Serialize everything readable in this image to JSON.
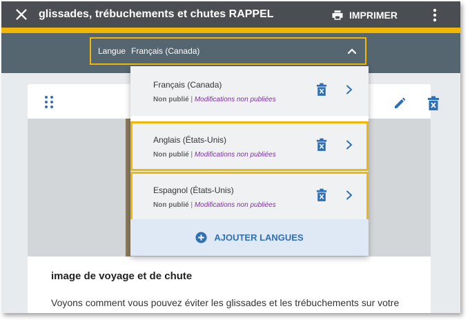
{
  "header": {
    "title": "glissades, trébuchements et chutes RAPPEL",
    "print_label": "IMPRIMER"
  },
  "language_selector": {
    "label": "Langue",
    "value": "Français (Canada)"
  },
  "languages": [
    {
      "name": "Français (Canada)",
      "status": "Non publié",
      "separator": "|",
      "changes": "Modifications non publiées",
      "highlighted": false
    },
    {
      "name": "Anglais (États-Unis)",
      "status": "Non publié",
      "separator": "|",
      "changes": "Modifications non publiées",
      "highlighted": true
    },
    {
      "name": "Espagnol (États-Unis)",
      "status": "Non publié",
      "separator": "|",
      "changes": "Modifications non publiées",
      "highlighted": true
    }
  ],
  "add_languages_label": "AJOUTER LANGUES",
  "content": {
    "heading": "image de voyage et de chute",
    "body": "Voyons comment vous pouvez éviter les glissades et les trébuchements sur votre"
  },
  "colors": {
    "topbar": "#4a4e52",
    "accent": "#f2b705",
    "language_bar": "#556670",
    "link_blue": "#2f6fb3",
    "changes_purple": "#7b2fa3"
  },
  "icons": {
    "close": "close-icon",
    "print": "printer-icon",
    "more": "more-vertical-icon",
    "chevron": "chevron-up-icon",
    "drag": "drag-handle-icon",
    "edit": "pencil-icon",
    "delete": "trash-icon",
    "next": "chevron-right-icon",
    "add": "plus-circle-icon"
  }
}
